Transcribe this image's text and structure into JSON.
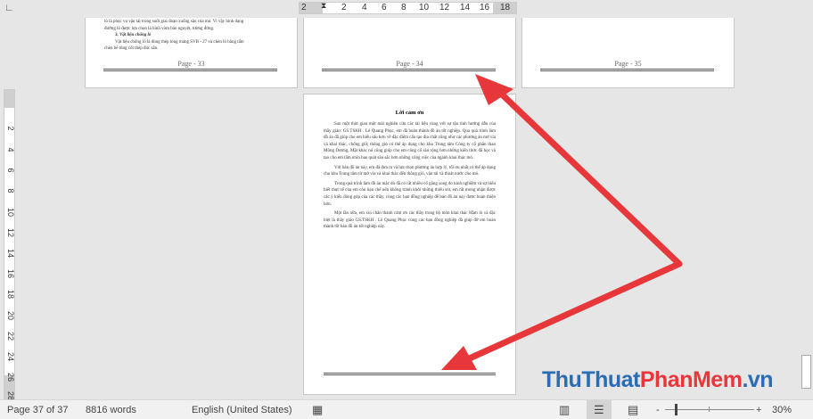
{
  "ruler": {
    "horizontal": [
      "2",
      "2",
      "4",
      "6",
      "8",
      "10",
      "12",
      "14",
      "16",
      "18"
    ],
    "vertical": [
      "2",
      "4",
      "6",
      "8",
      "10",
      "12",
      "14",
      "16",
      "18",
      "20",
      "22",
      "24",
      "26",
      "28"
    ]
  },
  "pages": {
    "p33": {
      "lines": [
        "lò là phục vụ vận tải trong suốt giai đoạn xuống sâu của mỏ. Vì vậy hình dạng",
        "đường lò được lựa chọn là hình vòm bán nguyệt, tường đứng.",
        "3. Vật liệu chống lò",
        "Vật liệu chống lò là dùng thép lòng máng SVB - 27 và chèn lò bằng tấm",
        "chèn bê tông cốt thép đúc sẵn."
      ],
      "footer": "Page - 33"
    },
    "p34": {
      "footer": "Page - 34"
    },
    "p35": {
      "footer": "Page - 35"
    },
    "p37": {
      "title": "Lời cảm ơn",
      "paragraphs": [
        "Sau một thời gian một mải nghiên cứu các tài liệu cùng với sự tận tình hướng dẫn của thầy giáo: GS.TSKH . Lê Quang Phục, em đã hoàn thành đồ án tốt nghiệp. Qua quá trình làm đồ án đã giúp cho em hiểu sâu hơn về đặc điểm cấu tạo địa chất cũng như các phương án mở vỉa và khai thác, chống giữ, thông gió có thể áp dụng cho khu Trung tâm Công ty cổ phần than Mông Dương. Mặt khác nó cũng giúp cho em củng cố sâu rộng hơn những kiến thức đã học và tạo cho em tầm nhìn bao quát sâu sắc hơn những công việc của ngành khai thác mỏ.",
        "Với bản đồ án này, em đã đưa ra và lựa chọn phương án hợp lý, tối ưu nhất có thể áp dụng cho khu Trung tâm từ mở vỉa và khai thác đến thông gió, vận tải và thoát nước cho mỏ.",
        "Trong quá trình làm đồ án mặc dù đã có rất nhiều cố gắng song do kinh nghiệm và sự hiểu biết thực tế của em còn hạn chế nên không tránh khỏi những thiếu sót, em rất mong nhận được các ý kiến đóng góp của các thầy, cùng các bạn đồng nghiệp để bản đồ án này được hoàn thiện hơn.",
        "Một lần nữa, em xin chân thành cảm ơn các thầy trong bộ môn khai thác Hầm lò và đặc biệt là thầy giáo GS.TSKH . Lê Quang Phục cùng các bạn đồng nghiệp đã giúp đỡ em hoàn thành tốt bản đồ án tốt nghiệp này."
      ]
    }
  },
  "status": {
    "page": "Page 37 of 37",
    "words": "8816 words",
    "language": "English (United States)",
    "zoom_minus": "-",
    "zoom_plus": "+",
    "zoom": "30%",
    "zoom_percent": 30
  },
  "watermark": {
    "part1": "ThuThuat",
    "part2": "PhanMem",
    "part3": ".vn"
  },
  "colors": {
    "arrow": "#e8373a",
    "wm_blue": "#2a6db5",
    "wm_red": "#e8373a"
  }
}
